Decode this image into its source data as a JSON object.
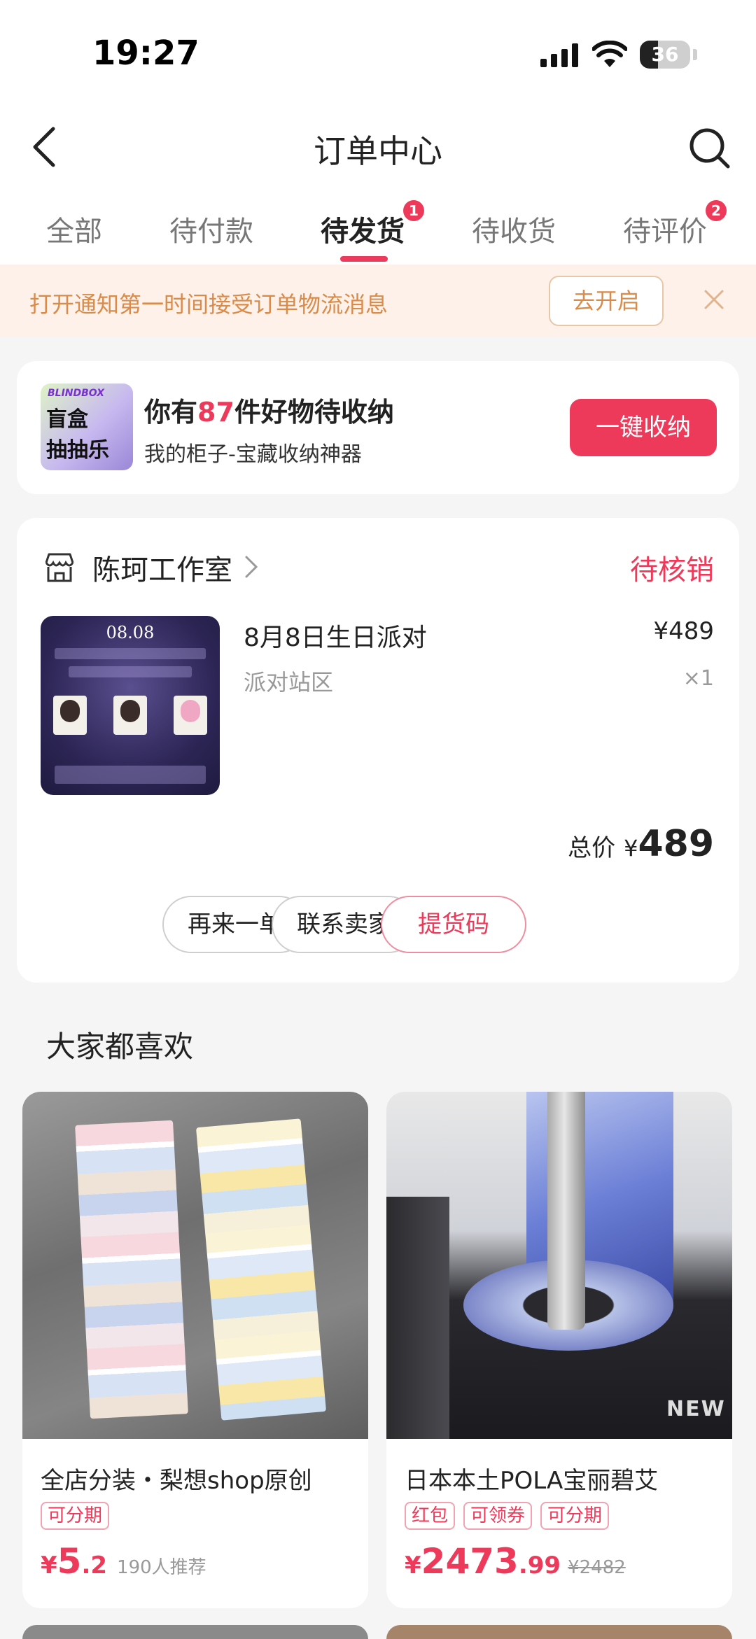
{
  "status_bar": {
    "time": "19:27",
    "battery": "36",
    "battery_level": 0.36
  },
  "nav": {
    "title": "订单中心"
  },
  "tabs": [
    {
      "label": "全部",
      "badge": ""
    },
    {
      "label": "待付款",
      "badge": ""
    },
    {
      "label": "待发货",
      "badge": "1",
      "active": true
    },
    {
      "label": "待收货",
      "badge": ""
    },
    {
      "label": "待评价",
      "badge": "2"
    }
  ],
  "notify": {
    "text": "打开通知第一时间接受订单物流消息",
    "button": "去开启"
  },
  "promo": {
    "logo_top": "BLINDBOX",
    "logo_line1": "盲盒",
    "logo_line2": "抽抽乐",
    "title_prefix": "你有",
    "title_count": "87",
    "title_suffix": "件好物待收纳",
    "subtitle": "我的柜子-宝藏收纳神器",
    "button": "一键收纳"
  },
  "order": {
    "shop_name": "陈珂工作室",
    "status": "待核销",
    "image_date": "08.08",
    "product_name": "8月8日生日派对",
    "product_spec": "派对站区",
    "price": "¥489",
    "quantity": "×1",
    "total_label": "总价",
    "total_currency": "¥",
    "total_value": "489",
    "buttons": [
      "再来一单",
      "联系卖家",
      "提货码"
    ]
  },
  "recommend": {
    "section_title": "大家都喜欢",
    "items": [
      {
        "title": "全店分装・梨想shop原创",
        "tags": [
          "可分期"
        ],
        "currency": "¥",
        "price_int": "5",
        "price_dec": ".2",
        "meta": "190人推荐",
        "original_price": ""
      },
      {
        "title": "日本本土POLA宝丽碧艾",
        "tags": [
          "红包",
          "可领券",
          "可分期"
        ],
        "currency": "¥",
        "price_int": "2473",
        "price_dec": ".99",
        "meta": "",
        "original_price": "¥2482",
        "image_text": "NEW"
      }
    ]
  },
  "colors": {
    "accent": "#ee3a5a",
    "notify_text": "#d98b4a",
    "notify_bg": "#fdf1ea"
  }
}
